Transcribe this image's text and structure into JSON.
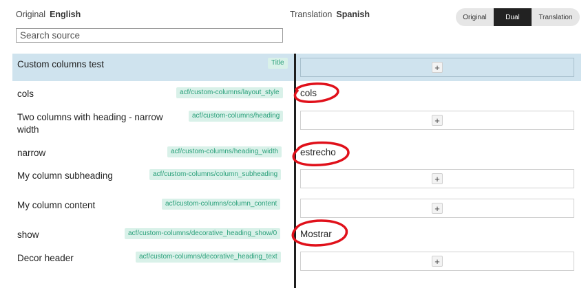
{
  "header": {
    "original_label": "Original",
    "original_lang": "English",
    "translation_label": "Translation",
    "translation_lang": "Spanish"
  },
  "search": {
    "placeholder": "Search source",
    "value": ""
  },
  "view_modes": {
    "options": [
      "Original",
      "Dual",
      "Translation"
    ],
    "selected": "Dual"
  },
  "rows": [
    {
      "source": "Custom columns test",
      "tag": "Title",
      "translation": "",
      "highlighted": true
    },
    {
      "source": "cols",
      "tag": "acf/custom-columns/layout_style",
      "translation": "cols"
    },
    {
      "source": "Two columns with heading - narrow width",
      "tag": "acf/custom-columns/heading",
      "translation": ""
    },
    {
      "source": "narrow",
      "tag": "acf/custom-columns/heading_width",
      "translation": "estrecho"
    },
    {
      "source": "My column subheading",
      "tag": "acf/custom-columns/column_subheading",
      "translation": ""
    },
    {
      "source": "My column content",
      "tag": "acf/custom-columns/column_content",
      "translation": ""
    },
    {
      "source": "show",
      "tag": "acf/custom-columns/decorative_heading_show/0",
      "translation": "Mostrar"
    },
    {
      "source": "Decor header",
      "tag": "acf/custom-columns/decorative_heading_text",
      "translation": ""
    }
  ],
  "add_button_glyph": "+",
  "annotation_color": "#e0101a",
  "accent_tag_color": "#2aa07a"
}
